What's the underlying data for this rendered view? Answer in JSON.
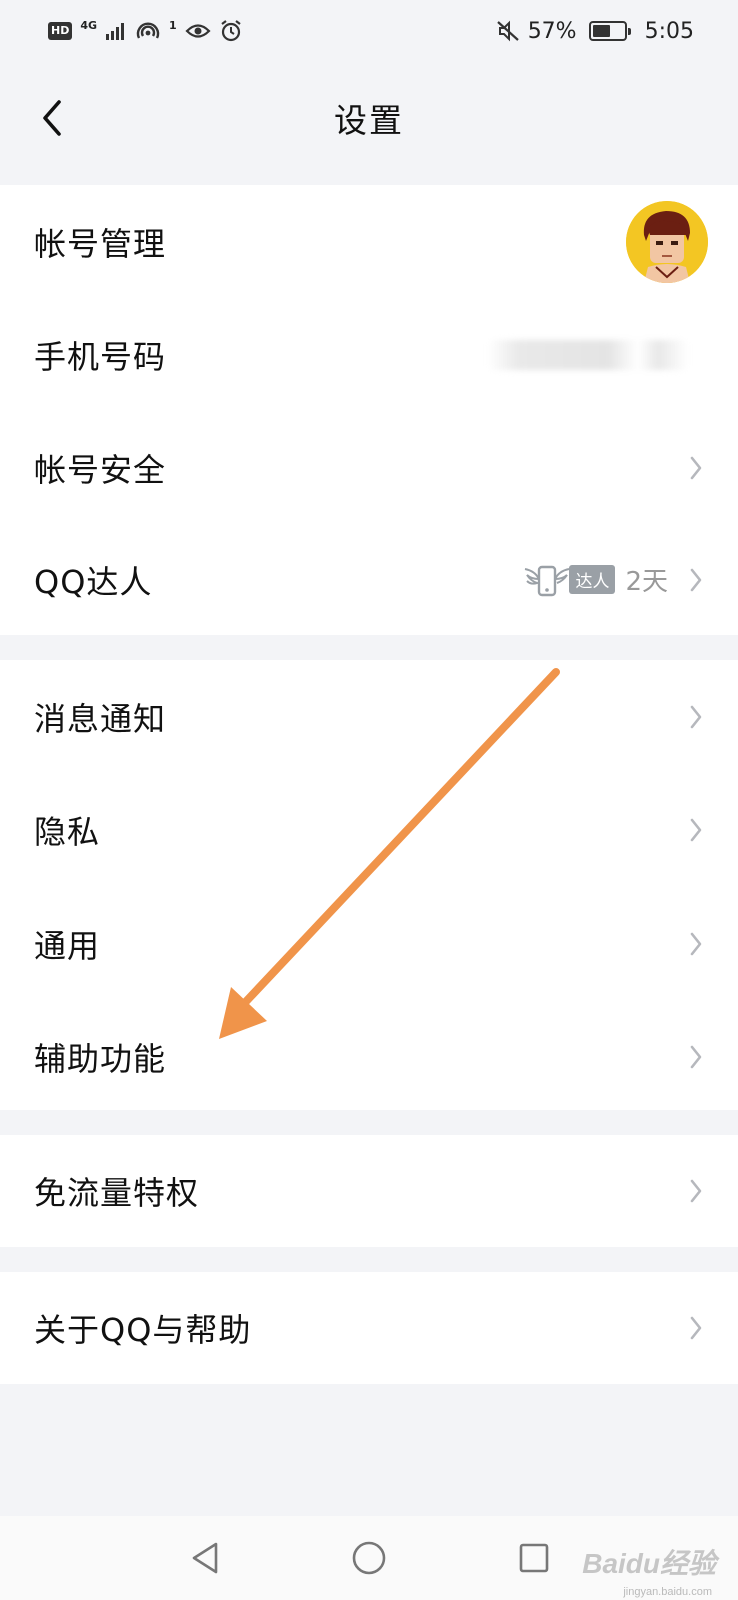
{
  "status_bar": {
    "hd": "HD",
    "network": "4G",
    "notif_count": "1",
    "battery_percent": "57%",
    "battery_level": 0.57,
    "time": "5:05"
  },
  "nav": {
    "title": "设置",
    "back_icon": "chevron-left-icon"
  },
  "groups": [
    {
      "items": [
        {
          "label": "帐号管理",
          "trailing": "avatar"
        },
        {
          "label": "手机号码",
          "trailing": "blurred-value"
        },
        {
          "label": "帐号安全",
          "trailing": "chevron"
        },
        {
          "label": "QQ达人",
          "trailing": "badge",
          "badge_text": "达人",
          "days": "2天"
        }
      ]
    },
    {
      "items": [
        {
          "label": "消息通知"
        },
        {
          "label": "隐私"
        },
        {
          "label": "通用"
        },
        {
          "label": "辅助功能"
        }
      ]
    },
    {
      "items": [
        {
          "label": "免流量特权"
        }
      ]
    },
    {
      "items": [
        {
          "label": "关于QQ与帮助"
        }
      ]
    }
  ],
  "annotation": {
    "arrow_color": "#f0944a",
    "points_to": "辅助功能"
  },
  "system_nav": {
    "back_icon": "triangle-back-icon",
    "home_icon": "circle-home-icon",
    "recents_icon": "square-recents-icon"
  },
  "watermark": {
    "text": "Baidu经验",
    "sub": "jingyan.baidu.com"
  }
}
